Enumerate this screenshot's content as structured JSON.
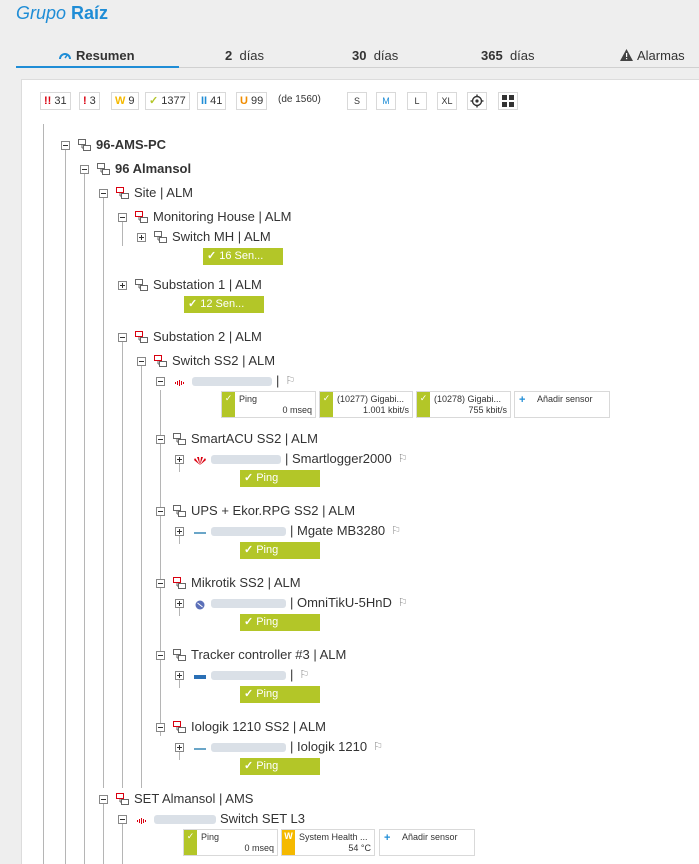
{
  "header": {
    "title_prefix": "Grupo",
    "title_main": "Raíz"
  },
  "tabs": [
    {
      "bold": "",
      "label": "Resumen",
      "icon": "gauge-icon",
      "active": true
    },
    {
      "bold": "2",
      "label": "días"
    },
    {
      "bold": "30",
      "label": "días"
    },
    {
      "bold": "365",
      "label": "días"
    },
    {
      "bold": "",
      "label": "Alarmas",
      "icon": "warning-icon"
    }
  ],
  "status_bar": {
    "down": {
      "symbol": "!!",
      "count": "31",
      "color": "#d9000f"
    },
    "down_ack": {
      "symbol": "!",
      "count": "3",
      "color": "#d9000f"
    },
    "warning": {
      "symbol": "W",
      "count": "9",
      "color": "#f5b900"
    },
    "up": {
      "symbol": "✓",
      "count": "1377",
      "color": "#b3c628"
    },
    "paused": {
      "symbol": "II",
      "count": "41",
      "color": "#1f8dd6"
    },
    "unusual": {
      "symbol": "U",
      "count": "99",
      "color": "#f08c00"
    },
    "total": "(de 1560)",
    "sizes": [
      "S",
      "M",
      "L",
      "XL"
    ],
    "active_size": "M",
    "icons": [
      "settings-icon",
      "grid-view-icon"
    ]
  },
  "tree": {
    "probe": "96-AMS-PC",
    "group": "96 Almansol",
    "site": "Site | ALM",
    "monitoring_house": "Monitoring House | ALM",
    "switch_mh": "Switch MH | ALM",
    "switch_mh_sensors": "16 Sen...",
    "substation1": "Substation 1 | ALM",
    "substation1_sensors": "12 Sen...",
    "substation2": "Substation 2 | ALM",
    "switch_ss2": "Switch SS2 | ALM",
    "ss2_device_sensors": [
      {
        "name": "Ping",
        "value": "0 mseq",
        "status": "up"
      },
      {
        "name": "(10277) Gigabi...",
        "value": "1.001 kbit/s",
        "status": "up"
      },
      {
        "name": "(10278) Gigabi...",
        "value": "755 kbit/s",
        "status": "up"
      }
    ],
    "add_sensor": "Añadir sensor",
    "smartacu": "SmartACU SS2 | ALM",
    "smartlogger": "| Smartlogger2000",
    "ups": "UPS + Ekor.RPG SS2 | ALM",
    "mgate": "| Mgate MB3280",
    "mikrotik": "Mikrotik SS2 | ALM",
    "omnitik": "| OmniTikU-5HnD",
    "tracker": "Tracker controller #3 | ALM",
    "tracker_dev": "|",
    "iologik": "Iologik 1210 SS2 | ALM",
    "iologik_dev": "| Iologik 1210",
    "ping": "Ping",
    "set_almansol": "SET Almansol | AMS",
    "switch_set_l3": "Switch SET L3",
    "set_sensors": [
      {
        "name": "Ping",
        "value": "0 mseq",
        "status": "up"
      },
      {
        "name": "System Health ...",
        "value": "54 °C",
        "status": "warning"
      }
    ]
  }
}
